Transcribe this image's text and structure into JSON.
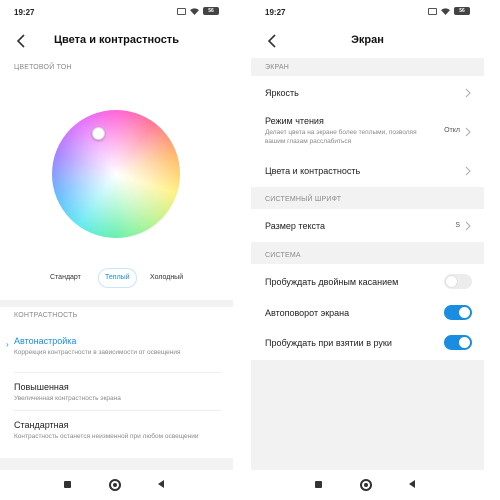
{
  "status": {
    "time": "19:27",
    "battery": "56"
  },
  "left": {
    "title": "Цвета и контрастность",
    "color_tone_header": "ЦВЕТОВОЙ ТОН",
    "temperature": [
      "Стандарт",
      "Теплый",
      "Холодный"
    ],
    "contrast_header": "КОНТРАСТНОСТЬ",
    "contrast_items": [
      {
        "title": "Автонастройка",
        "desc": "Коррекция контрастности в зависимости от освещения"
      },
      {
        "title": "Повышенная",
        "desc": "Увеличенная контрастность экрана"
      },
      {
        "title": "Стандартная",
        "desc": "Контрастность останется неизменной при любом освещении"
      }
    ]
  },
  "right": {
    "title": "Экран",
    "screen_header": "ЭКРАН",
    "brightness": "Яркость",
    "reading_mode": {
      "label": "Режим чтения",
      "desc": "Делает цвета на экране более теплыми, позволяя вашим глазам расслабиться",
      "value": "Откл"
    },
    "colors": "Цвета и контрастность",
    "font_header": "СИСТЕМНЫЙ ШРИФТ",
    "text_size": {
      "label": "Размер текста",
      "value": "S"
    },
    "system_header": "СИСТЕМА",
    "toggles": [
      {
        "label": "Пробуждать двойным касанием",
        "on": false
      },
      {
        "label": "Автоповорот экрана",
        "on": true
      },
      {
        "label": "Пробуждать при взятии в руки",
        "on": true
      }
    ]
  },
  "colors": {
    "accent": "#1a8de0",
    "toggle_off": "#ececec",
    "section_gray": "#f2f2f2"
  }
}
